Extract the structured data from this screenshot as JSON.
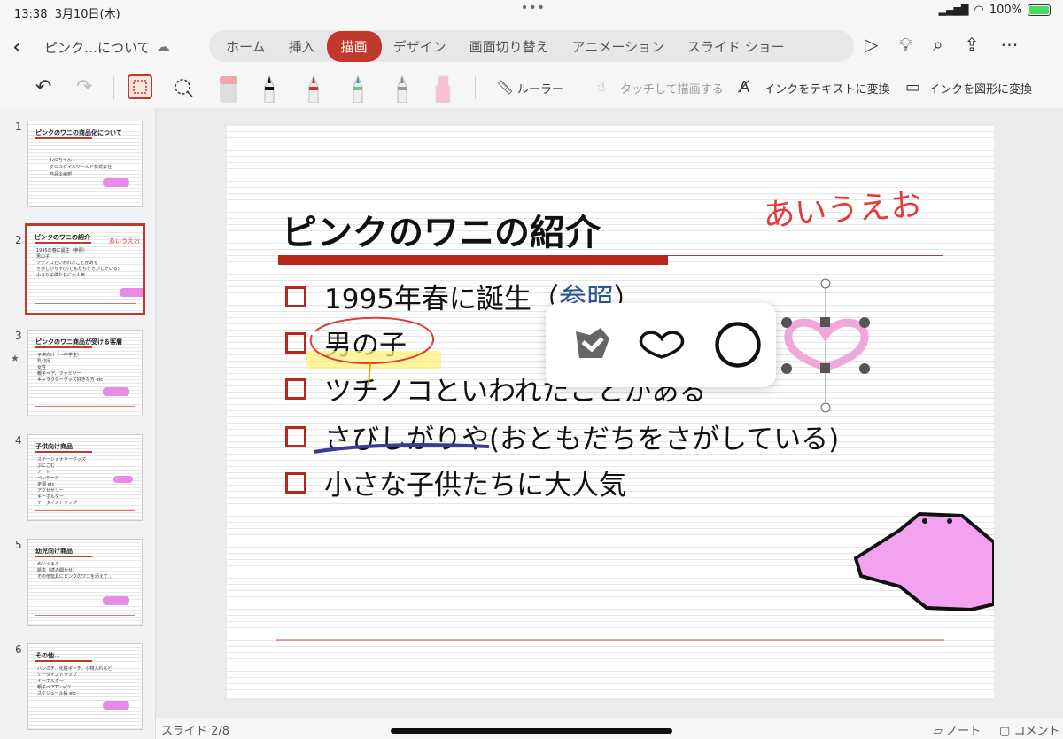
{
  "status": {
    "time": "13:38",
    "date": "3月10日(木)",
    "battery": "100%"
  },
  "doc": {
    "title": "ピンク…について"
  },
  "tabs": [
    {
      "label": "ホーム",
      "active": false
    },
    {
      "label": "挿入",
      "active": false
    },
    {
      "label": "描画",
      "active": true
    },
    {
      "label": "デザイン",
      "active": false
    },
    {
      "label": "画面切り替え",
      "active": false
    },
    {
      "label": "アニメーション",
      "active": false
    },
    {
      "label": "スライド ショー",
      "active": false
    }
  ],
  "toolbar": {
    "ruler": "ルーラー",
    "touch_draw": "タッチして描画する",
    "ink_to_text": "インクをテキストに変換",
    "ink_to_shape": "インクを図形に変換"
  },
  "thumbnails": [
    {
      "num": "1",
      "title": "ピンクのワニの商品化について",
      "lines": [
        "わにちゃん",
        "クロコダイルワールド株式会社",
        "商品企画部"
      ]
    },
    {
      "num": "2",
      "title": "ピンクのワニの紹介",
      "lines": [
        "1995年春に誕生（参照）",
        "男の子",
        "ツチノコといわれたことがある",
        "さびしがりや(おともだちをさがしている)",
        "小さな子供たちに大人気"
      ],
      "annot": "あいうえお"
    },
    {
      "num": "3",
      "title": "ピンクのワニ商品が受ける客層",
      "lines": [
        "子供向け（～中学生）",
        "乳幼児",
        "女性",
        "親子ペア、ファミリー",
        "キャラクターグッズ好きな方 etc"
      ]
    },
    {
      "num": "4",
      "title": "子供向け商品",
      "lines": [
        "ステーショナリーグッズ",
        "ぷにこむ",
        "ノート",
        "ペンケース",
        "定規 etc",
        "アクセサリー",
        "キーホルダー",
        "ケータイストラップ"
      ]
    },
    {
      "num": "5",
      "title": "幼児向け商品",
      "lines": [
        "ぬいぐるみ",
        "絵本（読み聞かせ）",
        "その他玩具にピンクのワニを添えて…"
      ]
    },
    {
      "num": "6",
      "title": "その他…",
      "lines": [
        "ハンカチ、化粧ポーチ、小物入れなど",
        "ケータイストラップ",
        "キーホルダー",
        "親子ペアTシャツ",
        "スケジュール帳 etc"
      ]
    }
  ],
  "slide": {
    "title": "ピンクのワニの紹介",
    "bullets": {
      "b1": "1995年春に誕生（",
      "b1_ref": "参照",
      "b1_end": "）",
      "b2": "男の子",
      "b3": "ツチノコといわれたことがある",
      "b4": "さびしがりや(おともだちをさがしている)",
      "b5": "小さな子供たちに大人気"
    },
    "handwriting": "あいうえお"
  },
  "bottom": {
    "slide_indicator": "スライド 2/8",
    "note": "ノート",
    "comment": "コメント"
  },
  "colors": {
    "accent": "#c0392b",
    "pink": "#e88be6",
    "ink_red": "#e23a3a"
  }
}
